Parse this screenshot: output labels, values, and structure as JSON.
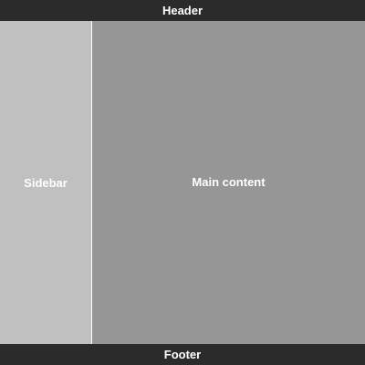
{
  "header": {
    "label": "Header",
    "color": "#2b2b2b"
  },
  "sidebar": {
    "label": "Sidebar",
    "color": "#c0c0c0"
  },
  "main": {
    "label": "Main content",
    "color": "#969696"
  },
  "footer": {
    "label": "Footer",
    "color": "#2b2b2b"
  }
}
